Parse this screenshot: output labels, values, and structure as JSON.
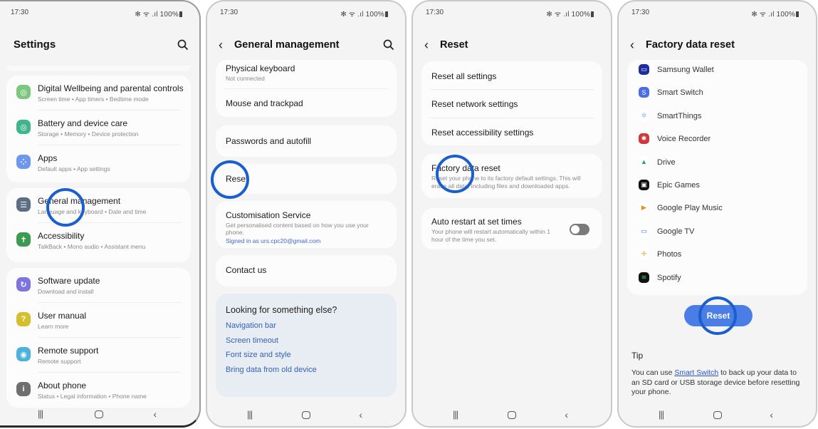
{
  "status_bar": {
    "time": "17:30",
    "icons": "✻ ᯤ .ıl",
    "battery": "100%"
  },
  "accent_color": "#1a5fcc",
  "screens": {
    "settings": {
      "title": "Settings",
      "search_icon": "search-icon",
      "items": [
        {
          "label": "Digital Wellbeing and parental controls",
          "sub": "Screen time  •  App timers  •  Bedtime mode",
          "icon": "wellbeing-icon",
          "color": "#7cc67d"
        },
        {
          "label": "Battery and device care",
          "sub": "Storage  •  Memory  •  Device protection",
          "icon": "device-care-icon",
          "color": "#3fb48e"
        },
        {
          "label": "Apps",
          "sub": "Default apps  •  App settings",
          "icon": "apps-icon",
          "color": "#6e98ee"
        },
        {
          "label": "General management",
          "sub": "Language and keyboard  •  Date and time",
          "icon": "general-management-icon",
          "color": "#5a6e86"
        },
        {
          "label": "Accessibility",
          "sub": "TalkBack  •  Mono audio  •  Assistant menu",
          "icon": "accessibility-icon",
          "color": "#3d9a53"
        },
        {
          "label": "Software update",
          "sub": "Download and install",
          "icon": "software-update-icon",
          "color": "#7c74e2"
        },
        {
          "label": "User manual",
          "sub": "Learn more",
          "icon": "user-manual-icon",
          "color": "#d3c02c"
        },
        {
          "label": "Remote support",
          "sub": "Remote support",
          "icon": "remote-support-icon",
          "color": "#4cb2dc"
        },
        {
          "label": "About phone",
          "sub": "Status  •  Legal information  •  Phone name",
          "icon": "about-phone-icon",
          "color": "#6f6f6f"
        }
      ]
    },
    "general_management": {
      "title": "General management",
      "items": [
        {
          "label": "Physical keyboard",
          "sub": "Not connected"
        },
        {
          "label": "Mouse and trackpad"
        },
        {
          "label": "Passwords and autofill"
        },
        {
          "label": "Reset"
        },
        {
          "label": "Customisation Service",
          "sub": "Get personalised content based on how you use your phone.",
          "sub2": "Signed in as urs.cpc20@gmail.com"
        },
        {
          "label": "Contact us"
        }
      ],
      "suggestions": {
        "heading": "Looking for something else?",
        "links": [
          "Navigation bar",
          "Screen timeout",
          "Font size and style",
          "Bring data from old device"
        ]
      }
    },
    "reset": {
      "title": "Reset",
      "items": [
        {
          "label": "Reset all settings"
        },
        {
          "label": "Reset network settings"
        },
        {
          "label": "Reset accessibility settings"
        },
        {
          "label": "Factory data reset",
          "sub": "Reset your phone to its factory default settings. This will erase all data, including files and downloaded apps."
        },
        {
          "label": "Auto restart at set times",
          "sub": "Your phone will restart automatically within 1 hour of the time you set.",
          "toggle_on": false
        }
      ]
    },
    "factory_reset": {
      "title": "Factory data reset",
      "apps": [
        {
          "name": "Samsung Wallet",
          "icon": "samsung-wallet-icon",
          "color": "#1d2f9e",
          "glyph": "▭"
        },
        {
          "name": "Smart Switch",
          "icon": "smart-switch-icon",
          "color": "#4a6fe0",
          "glyph": "S"
        },
        {
          "name": "SmartThings",
          "icon": "smartthings-icon",
          "color": "#ffffff",
          "glyph": "✲"
        },
        {
          "name": "Voice Recorder",
          "icon": "voice-recorder-icon",
          "color": "#d0393a",
          "glyph": "✱"
        },
        {
          "name": "Drive",
          "icon": "drive-icon",
          "color": "#ffffff",
          "glyph": "▲"
        },
        {
          "name": "Epic Games",
          "icon": "epic-games-icon",
          "color": "#111111",
          "glyph": "▣"
        },
        {
          "name": "Google Play Music",
          "icon": "google-play-music-icon",
          "color": "#ffffff",
          "glyph": "▶"
        },
        {
          "name": "Google TV",
          "icon": "google-tv-icon",
          "color": "#ffffff",
          "glyph": "▭"
        },
        {
          "name": "Photos",
          "icon": "photos-icon",
          "color": "#ffffff",
          "glyph": "✢"
        },
        {
          "name": "Spotify",
          "icon": "spotify-icon",
          "color": "#111111",
          "glyph": "≋"
        }
      ],
      "reset_button": "Reset",
      "tip_heading": "Tip",
      "tip_pre": "You can use ",
      "tip_link": "Smart Switch",
      "tip_post": " to back up your data to an SD card or USB storage device before resetting your phone."
    }
  },
  "navbar": {
    "recent": "|||",
    "home": "",
    "back": "‹"
  }
}
